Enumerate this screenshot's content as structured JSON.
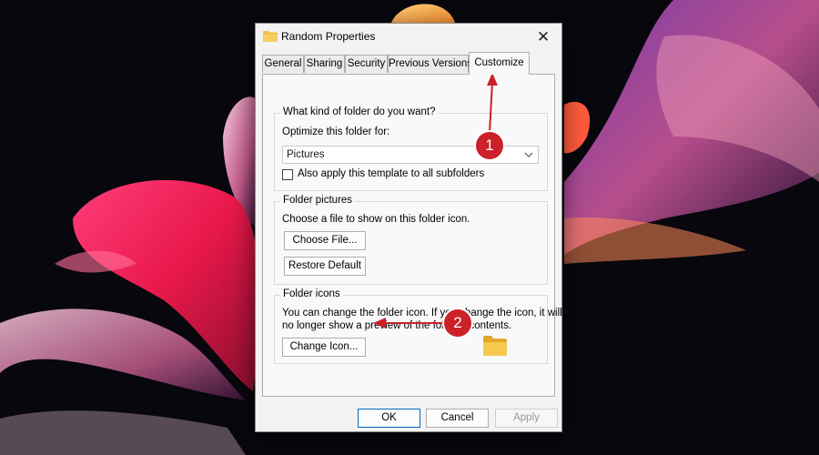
{
  "dialog": {
    "title": "Random Properties",
    "close_symbol": "✕",
    "icons": {
      "title": "folder-icon",
      "close": "close-icon",
      "preview": "folder-icon"
    }
  },
  "tabs": [
    {
      "label": "General"
    },
    {
      "label": "Sharing"
    },
    {
      "label": "Security"
    },
    {
      "label": "Previous Versions"
    },
    {
      "label": "Customize",
      "active": true
    }
  ],
  "folder_type": {
    "heading": "What kind of folder do you want?",
    "optimize_label": "Optimize this folder for:",
    "selected": "Pictures",
    "apply_label": "Also apply this template to all subfolders",
    "apply_checked": false
  },
  "folder_pictures": {
    "heading": "Folder pictures",
    "description": "Choose a file to show on this folder icon.",
    "choose_label": "Choose File...",
    "restore_label": "Restore Default"
  },
  "folder_icons": {
    "heading": "Folder icons",
    "description_line1": "You can change the folder icon. If you change the icon, it will",
    "description_line2": "no longer show a preview of the folder's contents.",
    "change_label": "Change Icon..."
  },
  "footer": {
    "ok": "OK",
    "cancel": "Cancel",
    "apply": "Apply"
  },
  "callouts": {
    "one": "1",
    "two": "2"
  },
  "colors": {
    "accent": "#0067c0",
    "callout": "#cc2129",
    "folder": "#f2c14e"
  }
}
